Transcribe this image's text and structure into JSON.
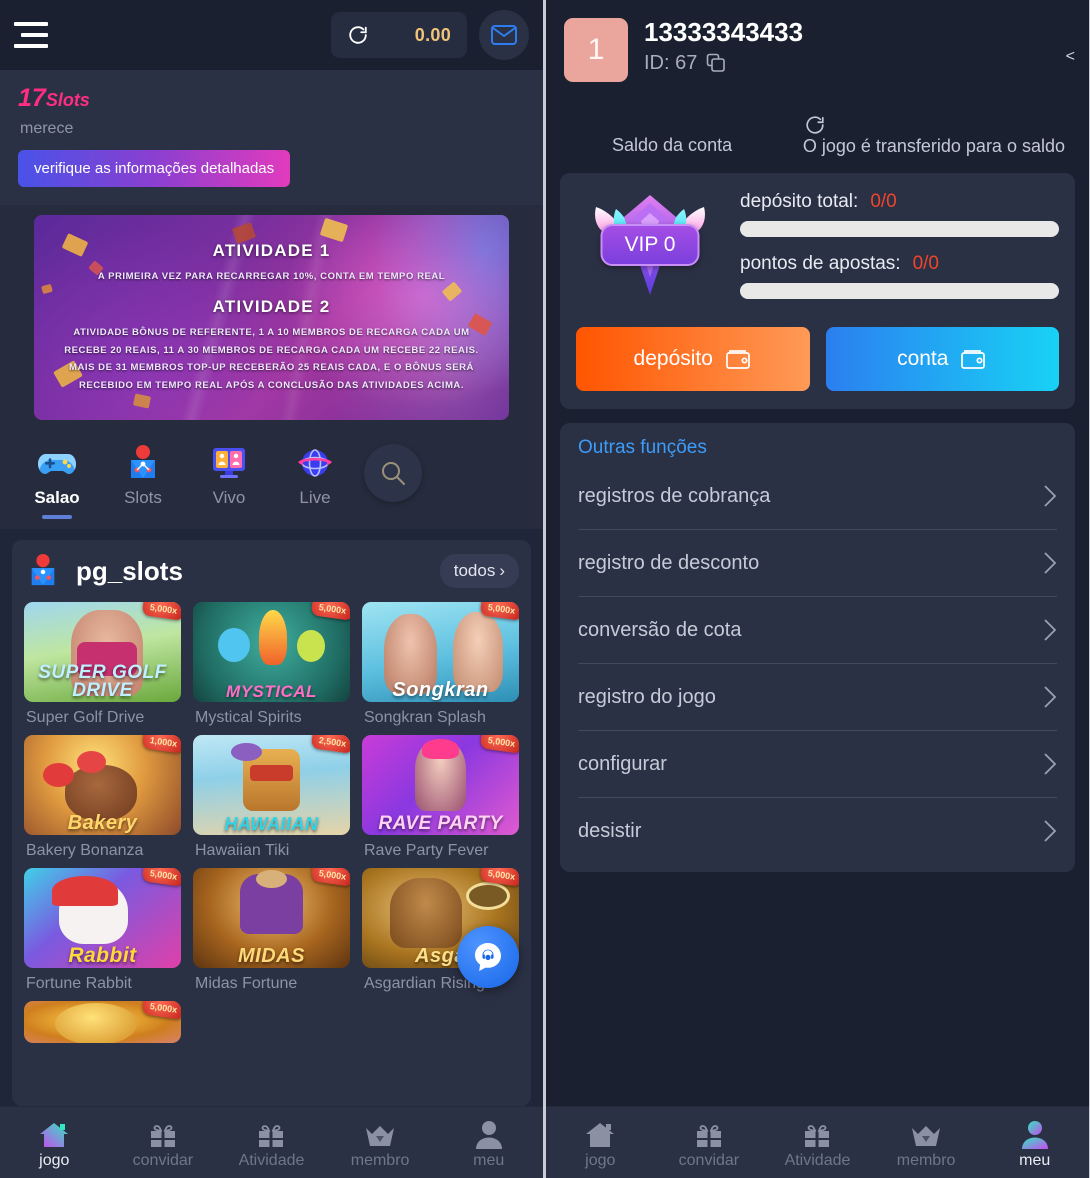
{
  "left": {
    "topbar": {
      "menu_icon": "hamburger-icon",
      "refresh_icon": "refresh-icon",
      "balance": "0.00",
      "mail_icon": "envelope-icon"
    },
    "promo": {
      "count": "17",
      "count_suffix": "Slots",
      "subtitle": "merece",
      "button_label": "verifique as informações detalhadas"
    },
    "banner": {
      "heading1": "ATIVIDADE 1",
      "text1": "A PRIMEIRA VEZ PARA RECARREGAR 10%, CONTA EM TEMPO REAL",
      "heading2": "ATIVIDADE 2",
      "text2": "ATIVIDADE BÔNUS DE REFERENTE, 1 A 10 MEMBROS DE RECARGA CADA UM RECEBE 20 REAIS, 11 A 30 MEMBROS DE RECARGA CADA UM RECEBE 22 REAIS. MAIS DE 31 MEMBROS TOP-UP RECEBERÃO 25 REAIS CADA, E O BÔNUS SERÁ RECEBIDO EM TEMPO REAL APÓS A CONCLUSÃO DAS ATIVIDADES ACIMA."
    },
    "categories": [
      {
        "label": "Salao",
        "icon": "gamepad-icon",
        "active": true
      },
      {
        "label": "Slots",
        "icon": "slot-pin-icon",
        "active": false
      },
      {
        "label": "Vivo",
        "icon": "monitor-icon",
        "active": false
      },
      {
        "label": "Live",
        "icon": "globe-icon",
        "active": false
      }
    ],
    "search_icon": "search-icon",
    "games": {
      "provider_icon": "pg-provider-icon",
      "title": "pg_slots",
      "all_label": "todos",
      "items": [
        {
          "name": "Super Golf Drive",
          "badge": "5,000x",
          "art_title": "SUPER GOLF DRIVE"
        },
        {
          "name": "Mystical Spirits",
          "badge": "5,000x",
          "art_title": "MYSTICAL"
        },
        {
          "name": "Songkran Splash",
          "badge": "5,000x",
          "art_title": "Songkran"
        },
        {
          "name": "Bakery Bonanza",
          "badge": "1,000x",
          "art_title": "Bakery"
        },
        {
          "name": "Hawaiian Tiki",
          "badge": "2,500x",
          "art_title": "HAWAIIAN"
        },
        {
          "name": "Rave Party Fever",
          "badge": "5,000x",
          "art_title": "RAVE PARTY"
        },
        {
          "name": "Fortune Rabbit",
          "badge": "5,000x",
          "art_title": "Rabbit"
        },
        {
          "name": "Midas Fortune",
          "badge": "5,000x",
          "art_title": "MIDAS"
        },
        {
          "name": "Asgardian Rising",
          "badge": "5,000x",
          "art_title": "Asga"
        }
      ]
    },
    "support_icon": "support-chat-icon",
    "bottom_nav": [
      {
        "label": "jogo",
        "icon": "home-icon",
        "active": true
      },
      {
        "label": "convidar",
        "icon": "gift-icon",
        "active": false
      },
      {
        "label": "Atividade",
        "icon": "gift-icon",
        "active": false
      },
      {
        "label": "membro",
        "icon": "crown-icon",
        "active": false
      },
      {
        "label": "meu",
        "icon": "person-icon",
        "active": false
      }
    ]
  },
  "right": {
    "avatar_text": "1",
    "username": "13333343433",
    "id_label": "ID: 67",
    "copy_icon": "copy-icon",
    "collapse_icon": "chevron-left-icon",
    "balance_label": "Saldo da conta",
    "transfer_icon": "refresh-icon",
    "transfer_label": "O jogo é transferido para o saldo",
    "vip": {
      "badge_icon": "vip-crown-icon",
      "level_label": "VIP 0",
      "deposit_label": "depósito total:",
      "deposit_value": "0/0",
      "deposit_progress": 0,
      "points_label": "pontos de apostas:",
      "points_value": "0/0",
      "points_progress": 0,
      "deposit_button": "depósito",
      "account_button": "conta",
      "wallet_icon": "wallet-icon"
    },
    "functions": {
      "title": "Outras funções",
      "items": [
        {
          "label": "registros de cobrança"
        },
        {
          "label": "registro de desconto"
        },
        {
          "label": "conversão de cota"
        },
        {
          "label": "registro do jogo"
        },
        {
          "label": "configurar"
        },
        {
          "label": "desistir"
        }
      ]
    },
    "bottom_nav": [
      {
        "label": "jogo",
        "icon": "home-icon",
        "active": false
      },
      {
        "label": "convidar",
        "icon": "gift-icon",
        "active": false
      },
      {
        "label": "Atividade",
        "icon": "gift-icon",
        "active": false
      },
      {
        "label": "membro",
        "icon": "crown-icon",
        "active": false
      },
      {
        "label": "meu",
        "icon": "person-icon",
        "active": true
      }
    ]
  },
  "colors": {
    "accent_pink": "#ff2e82",
    "accent_blue": "#3d9cf8",
    "danger_red": "#f0452a",
    "gold": "#f0c27a",
    "deposit_orange": "#ff5500",
    "account_blue": "#2b7ff0"
  }
}
